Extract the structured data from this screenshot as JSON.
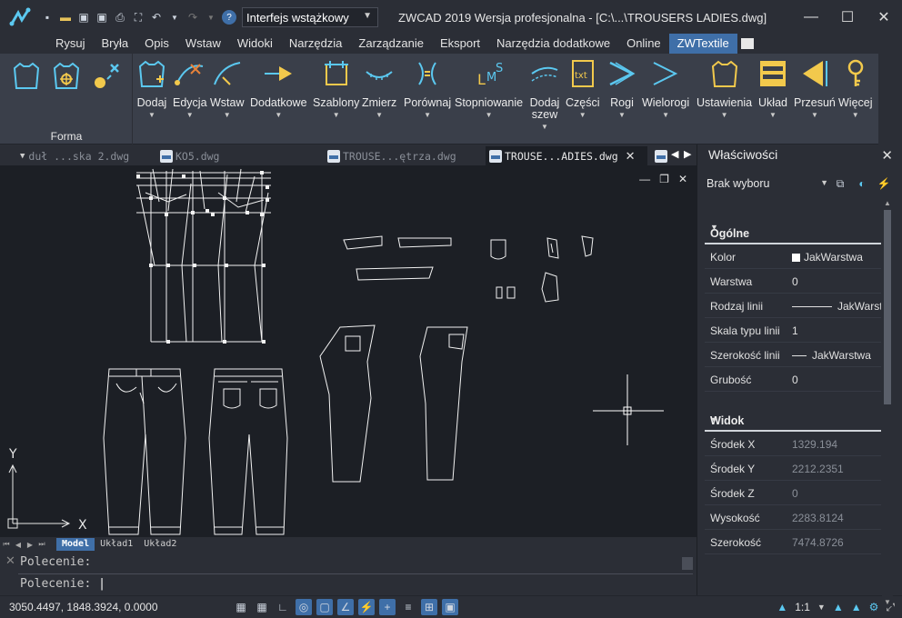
{
  "app": {
    "title": "ZWCAD 2019 Wersja profesjonalna - [C:\\...\\TROUSERS LADIES.dwg]",
    "workspace": "Interfejs wstążkowy"
  },
  "menu": [
    "Rysuj",
    "Bryła",
    "Opis",
    "Wstaw",
    "Widoki",
    "Narzędzia",
    "Zarządzanie",
    "Eksport",
    "Narzędzia dodatkowe",
    "Online",
    "ZWTextile"
  ],
  "ribbon": {
    "group_forma": "Forma",
    "buttons": [
      {
        "label": "Dodaj",
        "icon": "shirt-add-icon"
      },
      {
        "label": "Edycja",
        "icon": "edit-curve-icon"
      },
      {
        "label": "Wstaw",
        "icon": "insert-arc-icon"
      },
      {
        "label": "Dodatkowe",
        "icon": "arrow-right-icon"
      },
      {
        "label": "Szablony",
        "icon": "template-icon"
      },
      {
        "label": "Zmierz",
        "icon": "measure-icon"
      },
      {
        "label": "Porównaj",
        "icon": "compare-icon"
      },
      {
        "label": "Stopniowanie",
        "icon": "grading-icon"
      },
      {
        "label": "Dodaj szew",
        "icon": "seam-icon"
      },
      {
        "label": "Części",
        "icon": "parts-txt-icon"
      },
      {
        "label": "Rogi",
        "icon": "corners-icon"
      },
      {
        "label": "Wielorogi",
        "icon": "multi-corners-icon"
      },
      {
        "label": "Ustawienia",
        "icon": "settings-shirt-icon"
      },
      {
        "label": "Układ",
        "icon": "layout-icon"
      },
      {
        "label": "Przesuń",
        "icon": "move-icon"
      },
      {
        "label": "Więcej",
        "icon": "more-key-icon"
      }
    ]
  },
  "doc_tabs": [
    "duł ...ska 2.dwg",
    "KO5.dwg",
    "TROUSE...ętrza.dwg",
    "TROUSE...ADIES.dwg"
  ],
  "layout_tabs": [
    "Model",
    "Układ1",
    "Układ2"
  ],
  "command": {
    "line1": "Polecenie:",
    "line2": "Polecenie:"
  },
  "status": {
    "coords": "3050.4497, 1848.3924, 0.0000",
    "scale": "1:1"
  },
  "properties": {
    "title": "Właściwości",
    "selection": "Brak wyboru",
    "general": {
      "header": "Ogólne",
      "rows": [
        {
          "k": "Kolor",
          "v": "JakWarstwa"
        },
        {
          "k": "Warstwa",
          "v": "0"
        },
        {
          "k": "Rodzaj linii",
          "v": "JakWarst"
        },
        {
          "k": "Skala typu linii",
          "v": "1"
        },
        {
          "k": "Szerokość linii",
          "v": "JakWarstwa"
        },
        {
          "k": "Grubość",
          "v": "0"
        }
      ]
    },
    "view": {
      "header": "Widok",
      "rows": [
        {
          "k": "Środek X",
          "v": "1329.194"
        },
        {
          "k": "Środek Y",
          "v": "2212.2351"
        },
        {
          "k": "Środek Z",
          "v": "0"
        },
        {
          "k": "Wysokość",
          "v": "2283.8124"
        },
        {
          "k": "Szerokość",
          "v": "7474.8726"
        }
      ]
    }
  },
  "axes": {
    "x": "X",
    "y": "Y"
  },
  "colors": {
    "accent": "#3f6fa8",
    "ribbon_icon": "#5bc8f0",
    "canvas": "#1c1f25"
  }
}
